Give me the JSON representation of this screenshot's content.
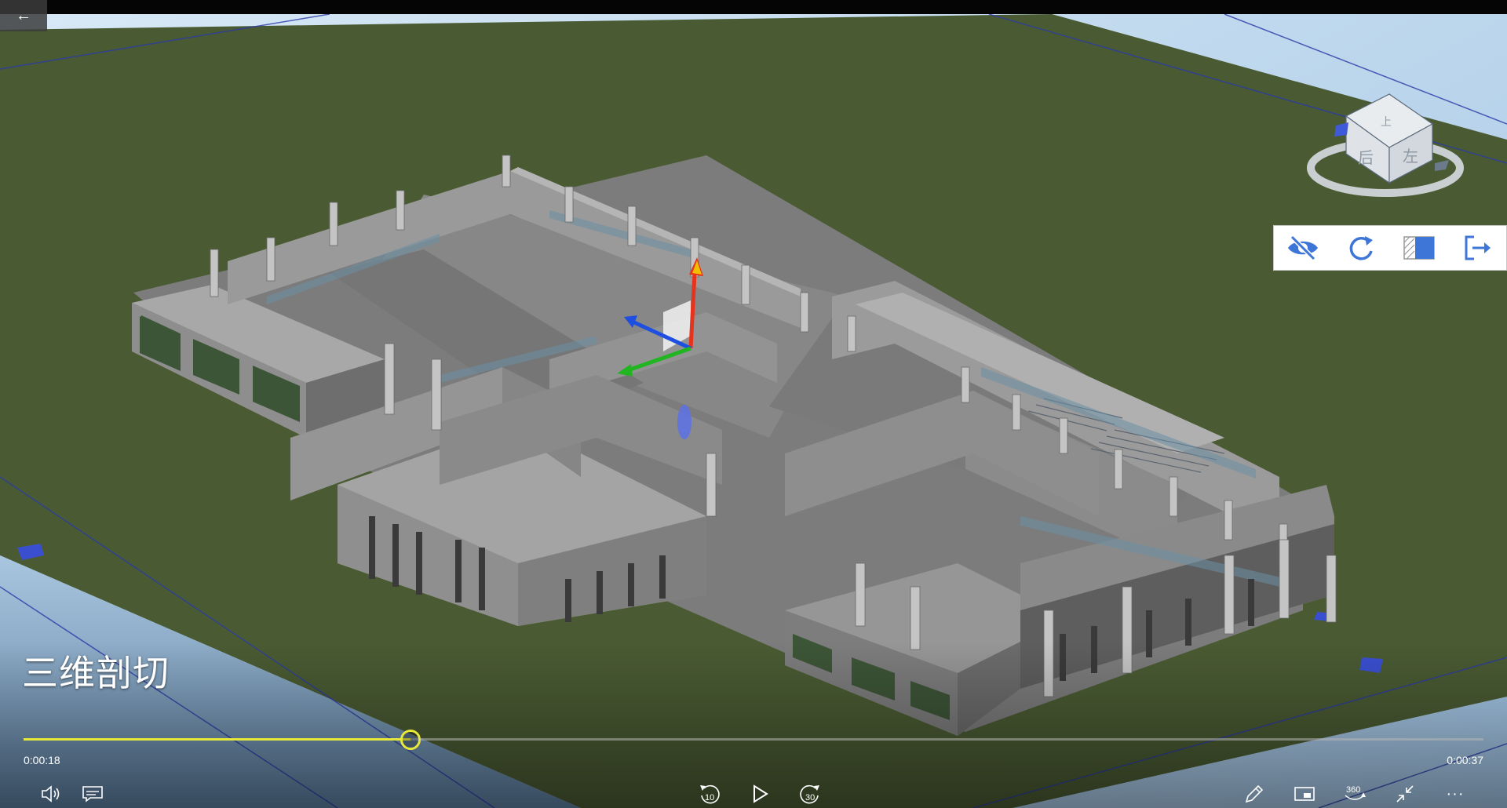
{
  "app": {
    "back_label": "←"
  },
  "caption": "三维剖切",
  "playback": {
    "current_time": "0:00:18",
    "total_time": "0:00:37",
    "progress": 0.265
  },
  "view_cube": {
    "faces": [
      "上",
      "后",
      "左"
    ]
  },
  "clip_toolbar": {
    "icons": [
      "eye-off-icon",
      "rotate-icon",
      "section-box-icon",
      "exit-icon"
    ],
    "accent": "#3e76d8"
  },
  "controls": {
    "left_icons": [
      "volume-icon",
      "subtitles-icon"
    ],
    "skip_back_label": "10",
    "skip_forward_label": "30",
    "right_icons": [
      "pen-icon",
      "miniview-icon",
      "360-icon",
      "collapse-icon",
      "more-icon"
    ],
    "view360_label": "360",
    "more_label": "···"
  },
  "colors": {
    "ground": "#4a5b33",
    "sky": "#b9d4ea",
    "building": "#8c8c8c",
    "axis_x": "#1f4fe0",
    "axis_y": "#22b522",
    "axis_z": "#e8331c",
    "progress": "#e6e83a"
  }
}
